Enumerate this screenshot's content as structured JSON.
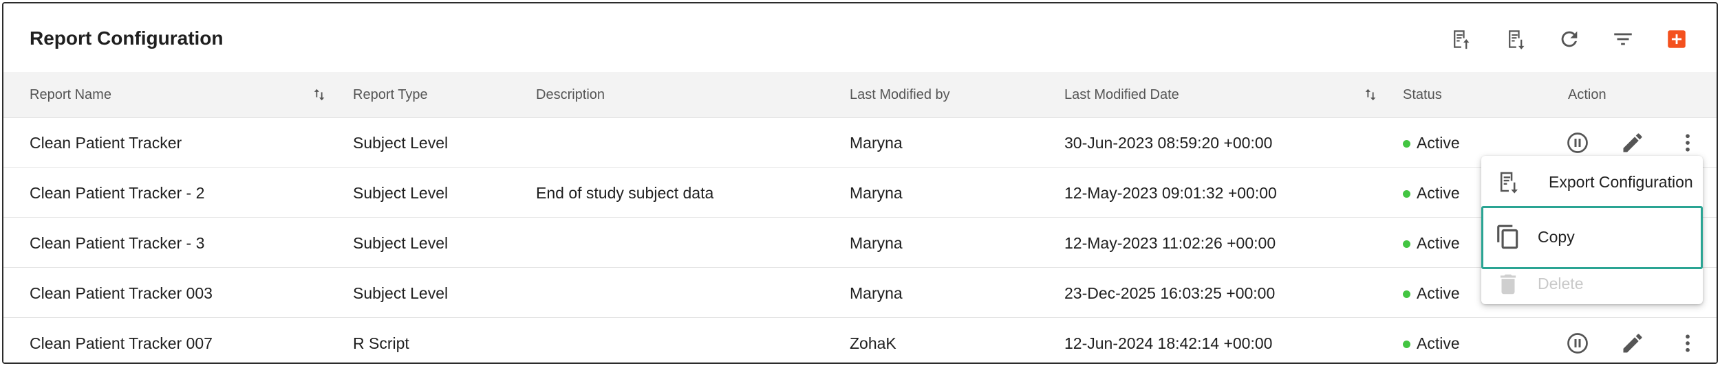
{
  "header": {
    "title": "Report Configuration",
    "toolbar": [
      {
        "name": "import-configuration-icon"
      },
      {
        "name": "export-configuration-icon"
      },
      {
        "name": "refresh-icon"
      },
      {
        "name": "filter-icon"
      },
      {
        "name": "add-icon",
        "color": "#f4511e"
      }
    ]
  },
  "table": {
    "columns": [
      "Report Name",
      "Report Type",
      "Description",
      "Last Modified by",
      "Last Modified Date",
      "Status",
      "Action"
    ],
    "rows": [
      {
        "name": "Clean Patient Tracker",
        "type": "Subject Level",
        "description": "",
        "modified_by": "Maryna",
        "modified_date": "30-Jun-2023 08:59:20 +00:00",
        "status": "Active"
      },
      {
        "name": "Clean Patient Tracker - 2",
        "type": "Subject Level",
        "description": "End of study subject data",
        "modified_by": "Maryna",
        "modified_date": "12-May-2023 09:01:32 +00:00",
        "status": "Active"
      },
      {
        "name": "Clean Patient Tracker - 3",
        "type": "Subject Level",
        "description": "",
        "modified_by": "Maryna",
        "modified_date": "12-May-2023 11:02:26 +00:00",
        "status": "Active"
      },
      {
        "name": "Clean Patient Tracker 003",
        "type": "Subject Level",
        "description": "",
        "modified_by": "Maryna",
        "modified_date": "23-Dec-2025 16:03:25 +00:00",
        "status": "Active"
      },
      {
        "name": "Clean Patient Tracker 007",
        "type": "R Script",
        "description": "",
        "modified_by": "ZohaK",
        "modified_date": "12-Jun-2024 18:42:14 +00:00",
        "status": "Active"
      }
    ]
  },
  "menu": {
    "items": [
      {
        "label": "Export Configuration",
        "icon": "export-configuration-icon",
        "disabled": false
      },
      {
        "label": "Copy",
        "icon": "copy-icon",
        "disabled": false,
        "highlighted": true
      },
      {
        "label": "Delete",
        "icon": "delete-icon",
        "disabled": true
      }
    ]
  },
  "colors": {
    "accent": "#f4511e",
    "status_active": "#43c542",
    "highlight": "#2aa493",
    "header_bg": "#f3f3f3"
  }
}
